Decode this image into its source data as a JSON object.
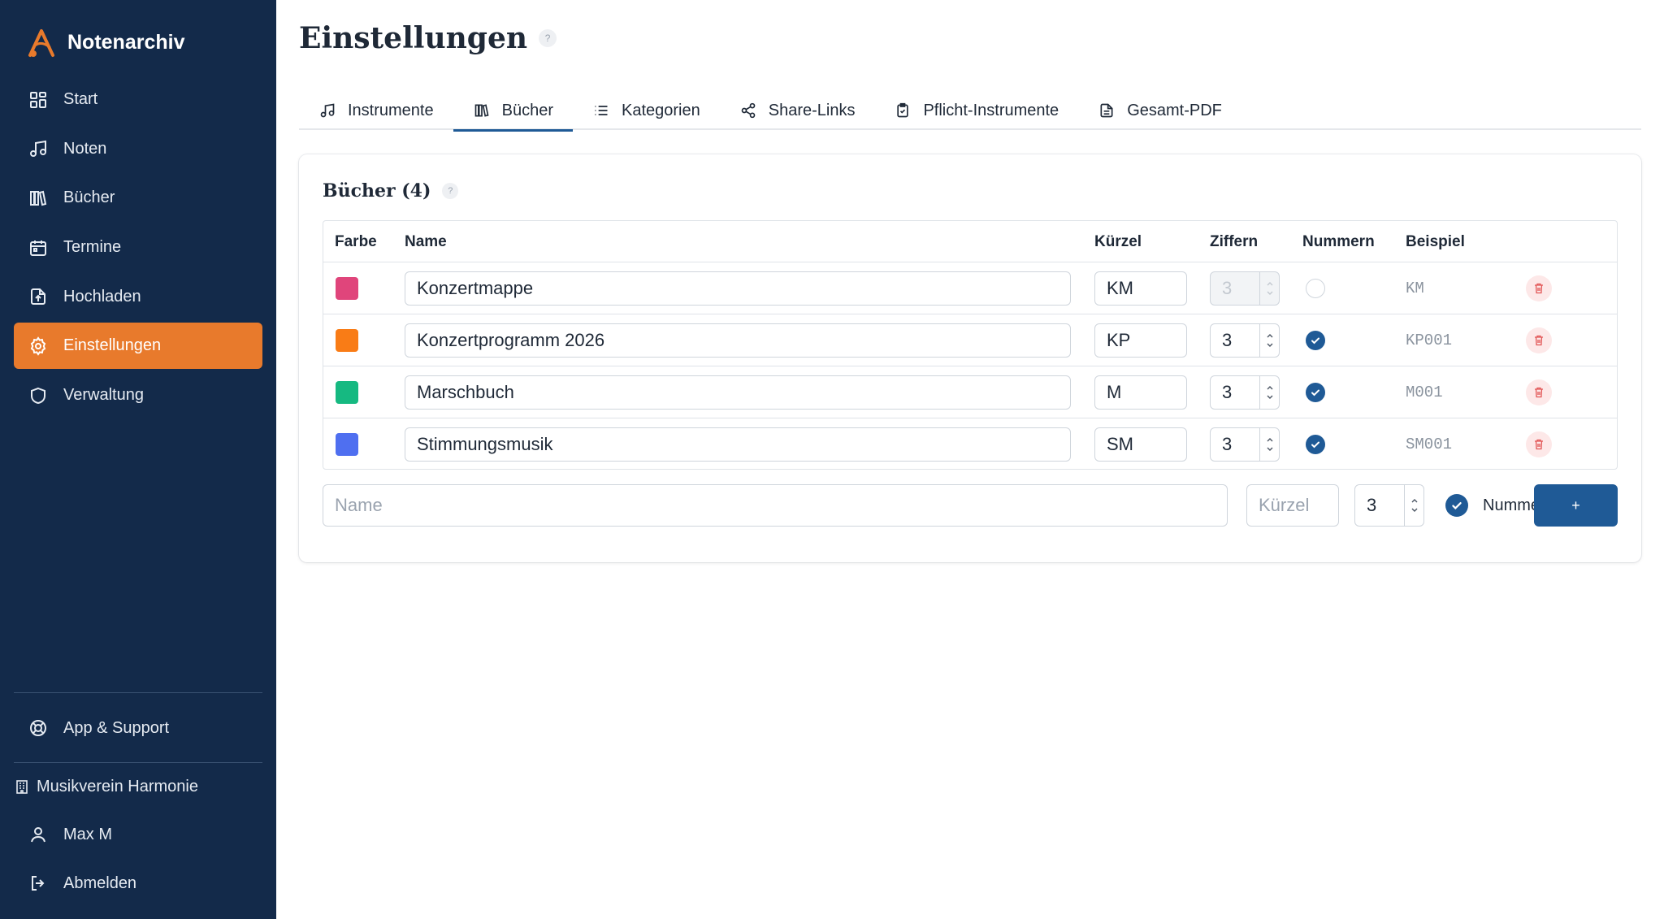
{
  "app": {
    "name": "Notenarchiv",
    "logo_icon": "music-a-logo-icon",
    "accent": "#e87a2c",
    "primary": "#1f5a96",
    "sidebar_bg": "#132a4a"
  },
  "sidebar": {
    "items": [
      {
        "label": "Start",
        "icon": "dashboard-icon"
      },
      {
        "label": "Noten",
        "icon": "music-note-icon"
      },
      {
        "label": "Bücher",
        "icon": "books-icon"
      },
      {
        "label": "Termine",
        "icon": "calendar-icon"
      },
      {
        "label": "Hochladen",
        "icon": "upload-file-icon"
      },
      {
        "label": "Einstellungen",
        "icon": "gear-icon"
      },
      {
        "label": "Verwaltung",
        "icon": "shield-icon"
      }
    ],
    "active": "Einstellungen",
    "support": "App & Support",
    "org": "Musikverein Harmonie",
    "user": "Max M",
    "logout": "Abmelden"
  },
  "page": {
    "title": "Einstellungen",
    "help": "?"
  },
  "tabs": [
    {
      "label": "Instrumente",
      "icon": "music-note-icon"
    },
    {
      "label": "Bücher",
      "icon": "books-icon"
    },
    {
      "label": "Kategorien",
      "icon": "list-icon"
    },
    {
      "label": "Share-Links",
      "icon": "share-icon"
    },
    {
      "label": "Pflicht-Instrumente",
      "icon": "clipboard-check-icon"
    },
    {
      "label": "Gesamt-PDF",
      "icon": "document-icon"
    }
  ],
  "active_tab": "Bücher",
  "books": {
    "title": "Bücher (4)",
    "help": "?",
    "columns": [
      "Farbe",
      "Name",
      "Kürzel",
      "Ziffern",
      "Nummern",
      "Beispiel"
    ],
    "rows": [
      {
        "color": "#e0457b",
        "name": "Konzertmappe",
        "abbr": "KM",
        "digits": "3",
        "numbered": false,
        "example": "KM"
      },
      {
        "color": "#f97c16",
        "name": "Konzertprogramm 2026",
        "abbr": "KP",
        "digits": "3",
        "numbered": true,
        "example": "KP001"
      },
      {
        "color": "#16b981",
        "name": "Marschbuch",
        "abbr": "M",
        "digits": "3",
        "numbered": true,
        "example": "M001"
      },
      {
        "color": "#4f6ff0",
        "name": "Stimmungsmusik",
        "abbr": "SM",
        "digits": "3",
        "numbered": true,
        "example": "SM001"
      }
    ],
    "new_row": {
      "name_placeholder": "Name",
      "abbr_placeholder": "Kürzel",
      "digits": "3",
      "numbered_label": "Nummern",
      "numbered": true,
      "add_label": "+"
    }
  }
}
